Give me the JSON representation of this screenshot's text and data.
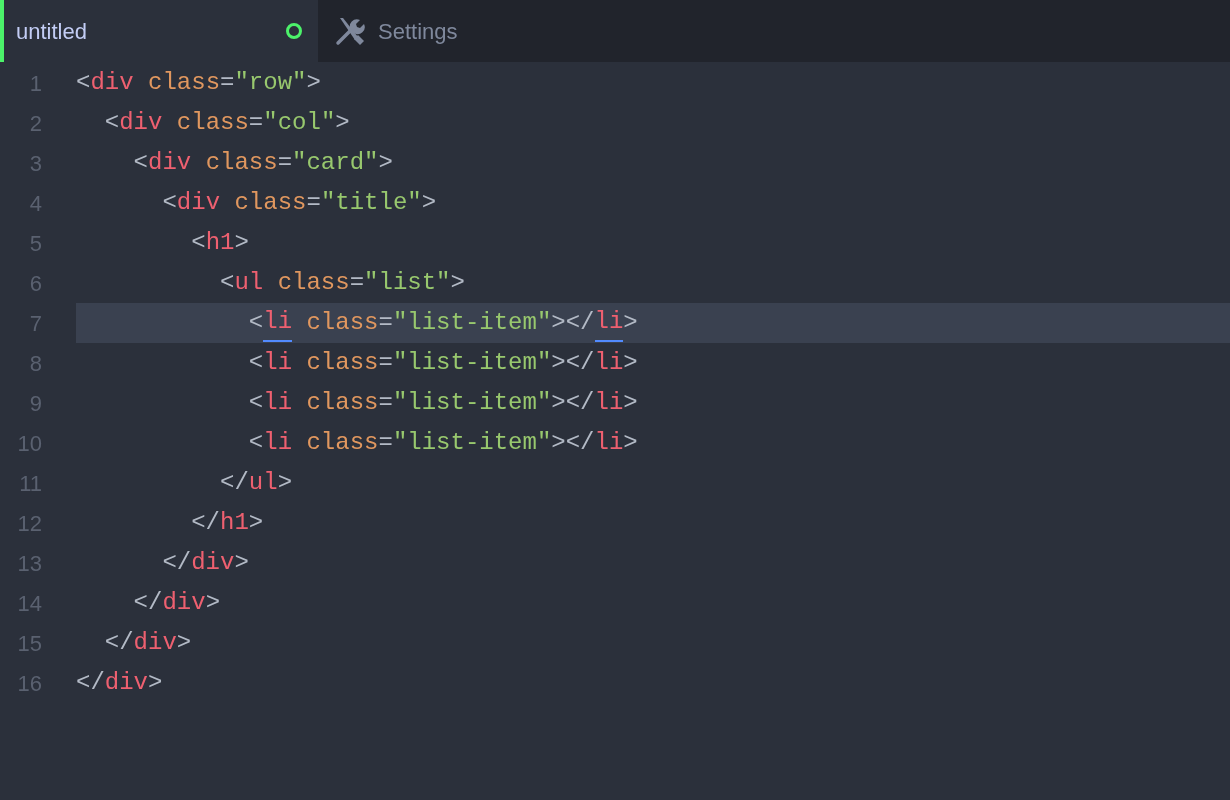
{
  "tabs": [
    {
      "label": "untitled",
      "selected": true,
      "modified": true,
      "kind": "file"
    },
    {
      "label": "Settings",
      "selected": false,
      "modified": false,
      "kind": "settings"
    }
  ],
  "editor": {
    "lines": [
      {
        "number": "1",
        "current": false,
        "tokens": [
          {
            "kind": "punct",
            "text": "<"
          },
          {
            "kind": "tag",
            "text": "div"
          },
          {
            "kind": "attr",
            "text": " class"
          },
          {
            "kind": "punct",
            "text": "="
          },
          {
            "kind": "string",
            "text": "\"row\""
          },
          {
            "kind": "punct",
            "text": ">"
          }
        ]
      },
      {
        "number": "2",
        "current": false,
        "tokens": [
          {
            "kind": "punct",
            "text": "  <"
          },
          {
            "kind": "tag",
            "text": "div"
          },
          {
            "kind": "attr",
            "text": " class"
          },
          {
            "kind": "punct",
            "text": "="
          },
          {
            "kind": "string",
            "text": "\"col\""
          },
          {
            "kind": "punct",
            "text": ">"
          }
        ]
      },
      {
        "number": "3",
        "current": false,
        "tokens": [
          {
            "kind": "punct",
            "text": "    <"
          },
          {
            "kind": "tag",
            "text": "div"
          },
          {
            "kind": "attr",
            "text": " class"
          },
          {
            "kind": "punct",
            "text": "="
          },
          {
            "kind": "string",
            "text": "\"card\""
          },
          {
            "kind": "punct",
            "text": ">"
          }
        ]
      },
      {
        "number": "4",
        "current": false,
        "tokens": [
          {
            "kind": "punct",
            "text": "      <"
          },
          {
            "kind": "tag",
            "text": "div"
          },
          {
            "kind": "attr",
            "text": " class"
          },
          {
            "kind": "punct",
            "text": "="
          },
          {
            "kind": "string",
            "text": "\"title\""
          },
          {
            "kind": "punct",
            "text": ">"
          }
        ]
      },
      {
        "number": "5",
        "current": false,
        "tokens": [
          {
            "kind": "punct",
            "text": "        <"
          },
          {
            "kind": "tag",
            "text": "h1"
          },
          {
            "kind": "punct",
            "text": ">"
          }
        ]
      },
      {
        "number": "6",
        "current": false,
        "tokens": [
          {
            "kind": "punct",
            "text": "          <"
          },
          {
            "kind": "tag",
            "text": "ul"
          },
          {
            "kind": "attr",
            "text": " class"
          },
          {
            "kind": "punct",
            "text": "="
          },
          {
            "kind": "string",
            "text": "\"list\""
          },
          {
            "kind": "punct",
            "text": ">"
          }
        ]
      },
      {
        "number": "7",
        "current": true,
        "tokens": [
          {
            "kind": "punct",
            "text": "            <"
          },
          {
            "kind": "tag",
            "text": "li",
            "matched": true
          },
          {
            "kind": "attr",
            "text": " class"
          },
          {
            "kind": "punct",
            "text": "="
          },
          {
            "kind": "string",
            "text": "\"list-item\""
          },
          {
            "kind": "punct",
            "text": "></"
          },
          {
            "kind": "tag",
            "text": "li",
            "matched": true
          },
          {
            "kind": "punct",
            "text": ">"
          }
        ]
      },
      {
        "number": "8",
        "current": false,
        "tokens": [
          {
            "kind": "punct",
            "text": "            <"
          },
          {
            "kind": "tag",
            "text": "li"
          },
          {
            "kind": "attr",
            "text": " class"
          },
          {
            "kind": "punct",
            "text": "="
          },
          {
            "kind": "string",
            "text": "\"list-item\""
          },
          {
            "kind": "punct",
            "text": "></"
          },
          {
            "kind": "tag",
            "text": "li"
          },
          {
            "kind": "punct",
            "text": ">"
          }
        ]
      },
      {
        "number": "9",
        "current": false,
        "tokens": [
          {
            "kind": "punct",
            "text": "            <"
          },
          {
            "kind": "tag",
            "text": "li"
          },
          {
            "kind": "attr",
            "text": " class"
          },
          {
            "kind": "punct",
            "text": "="
          },
          {
            "kind": "string",
            "text": "\"list-item\""
          },
          {
            "kind": "punct",
            "text": "></"
          },
          {
            "kind": "tag",
            "text": "li"
          },
          {
            "kind": "punct",
            "text": ">"
          }
        ]
      },
      {
        "number": "10",
        "current": false,
        "tokens": [
          {
            "kind": "punct",
            "text": "            <"
          },
          {
            "kind": "tag",
            "text": "li"
          },
          {
            "kind": "attr",
            "text": " class"
          },
          {
            "kind": "punct",
            "text": "="
          },
          {
            "kind": "string",
            "text": "\"list-item\""
          },
          {
            "kind": "punct",
            "text": "></"
          },
          {
            "kind": "tag",
            "text": "li"
          },
          {
            "kind": "punct",
            "text": ">"
          }
        ]
      },
      {
        "number": "11",
        "current": false,
        "tokens": [
          {
            "kind": "punct",
            "text": "          </"
          },
          {
            "kind": "tag",
            "text": "ul"
          },
          {
            "kind": "punct",
            "text": ">"
          }
        ]
      },
      {
        "number": "12",
        "current": false,
        "tokens": [
          {
            "kind": "punct",
            "text": "        </"
          },
          {
            "kind": "tag",
            "text": "h1"
          },
          {
            "kind": "punct",
            "text": ">"
          }
        ]
      },
      {
        "number": "13",
        "current": false,
        "tokens": [
          {
            "kind": "punct",
            "text": "      </"
          },
          {
            "kind": "tag",
            "text": "div"
          },
          {
            "kind": "punct",
            "text": ">"
          }
        ]
      },
      {
        "number": "14",
        "current": false,
        "tokens": [
          {
            "kind": "punct",
            "text": "    </"
          },
          {
            "kind": "tag",
            "text": "div"
          },
          {
            "kind": "punct",
            "text": ">"
          }
        ]
      },
      {
        "number": "15",
        "current": false,
        "tokens": [
          {
            "kind": "punct",
            "text": "  </"
          },
          {
            "kind": "tag",
            "text": "div"
          },
          {
            "kind": "punct",
            "text": ">"
          }
        ]
      },
      {
        "number": "16",
        "current": false,
        "tokens": [
          {
            "kind": "punct",
            "text": "</"
          },
          {
            "kind": "tag",
            "text": "div"
          },
          {
            "kind": "punct",
            "text": ">"
          }
        ]
      }
    ]
  }
}
